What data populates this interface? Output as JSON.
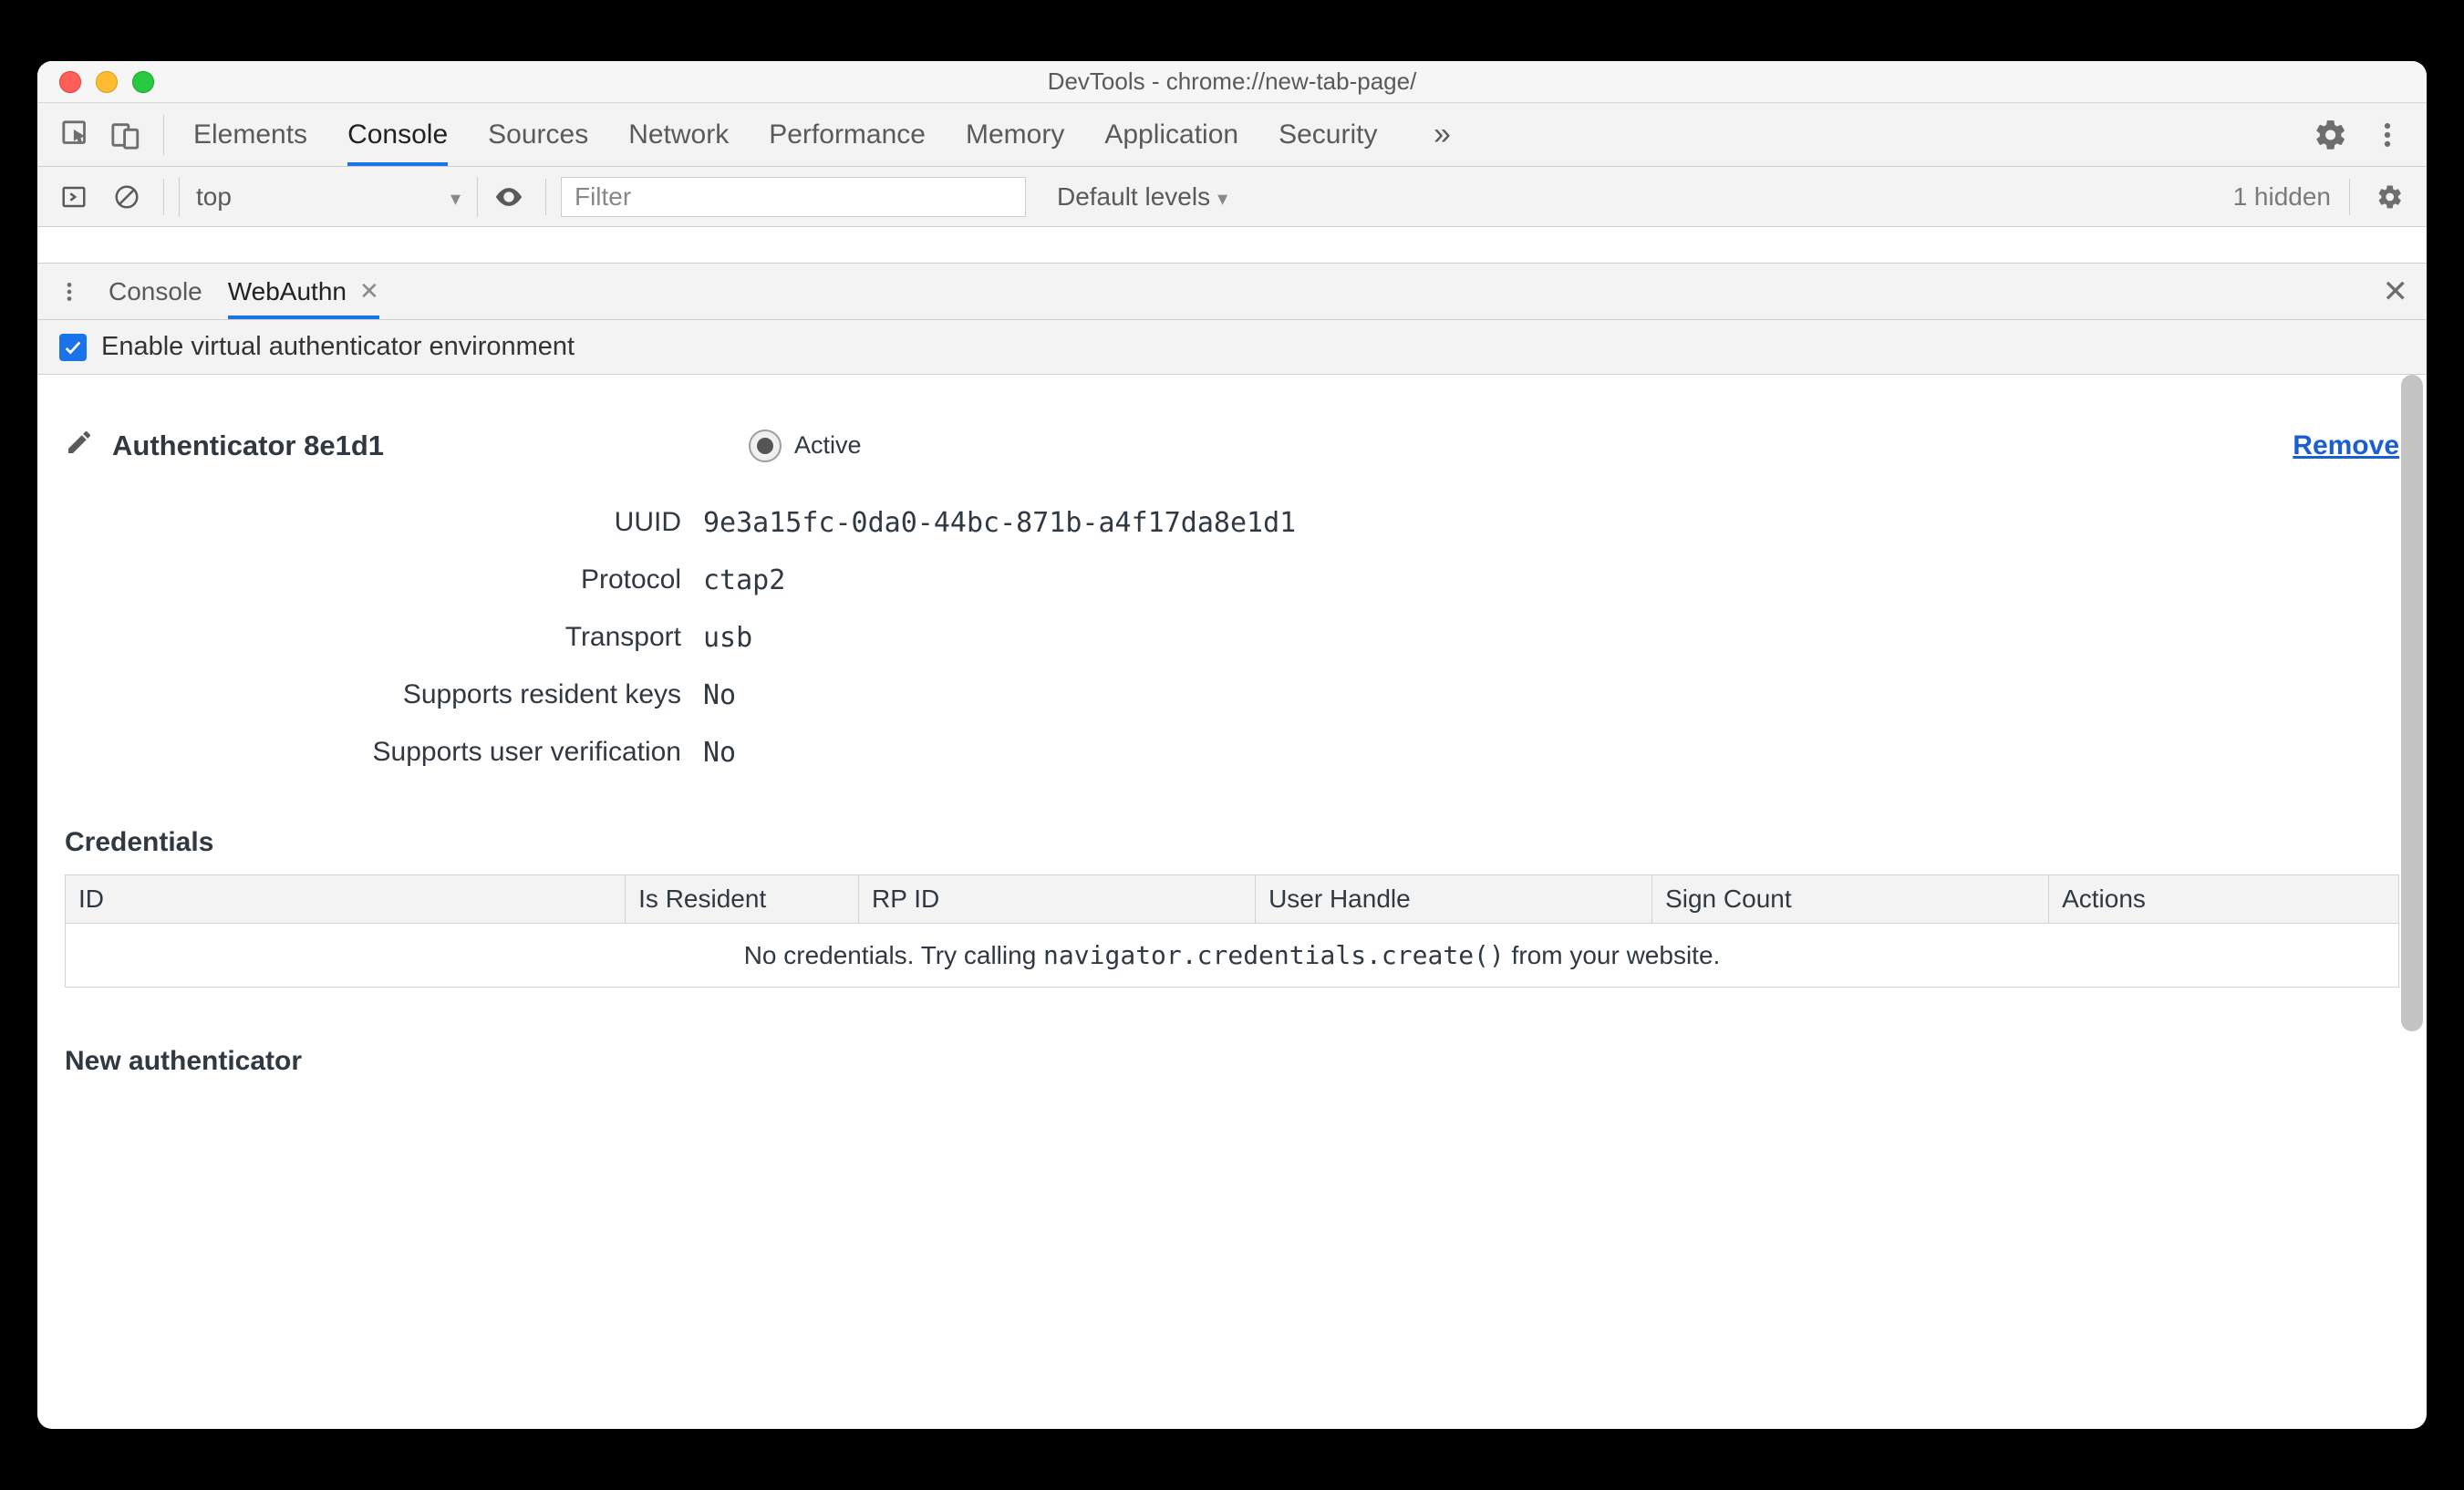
{
  "window": {
    "title": "DevTools - chrome://new-tab-page/"
  },
  "tabstrip": {
    "tabs": [
      "Elements",
      "Console",
      "Sources",
      "Network",
      "Performance",
      "Memory",
      "Application",
      "Security"
    ],
    "active_index": 1,
    "overflow_glyph": "»"
  },
  "console_toolbar": {
    "context": "top",
    "filter_placeholder": "Filter",
    "levels_label": "Default levels",
    "hidden_label": "1 hidden"
  },
  "drawer": {
    "tabs": [
      {
        "label": "Console",
        "closable": false
      },
      {
        "label": "WebAuthn",
        "closable": true
      }
    ],
    "active_index": 1
  },
  "enable": {
    "checked": true,
    "label": "Enable virtual authenticator environment"
  },
  "authenticator": {
    "title": "Authenticator 8e1d1",
    "active_label": "Active",
    "remove_label": "Remove",
    "fields": {
      "uuid_label": "UUID",
      "uuid_value": "9e3a15fc-0da0-44bc-871b-a4f17da8e1d1",
      "protocol_label": "Protocol",
      "protocol_value": "ctap2",
      "transport_label": "Transport",
      "transport_value": "usb",
      "resident_label": "Supports resident keys",
      "resident_value": "No",
      "userver_label": "Supports user verification",
      "userver_value": "No"
    }
  },
  "credentials": {
    "heading": "Credentials",
    "columns": [
      "ID",
      "Is Resident",
      "RP ID",
      "User Handle",
      "Sign Count",
      "Actions"
    ],
    "empty_prefix": "No credentials. Try calling ",
    "empty_code": "navigator.credentials.create()",
    "empty_suffix": " from your website."
  },
  "new_auth": {
    "heading": "New authenticator"
  }
}
